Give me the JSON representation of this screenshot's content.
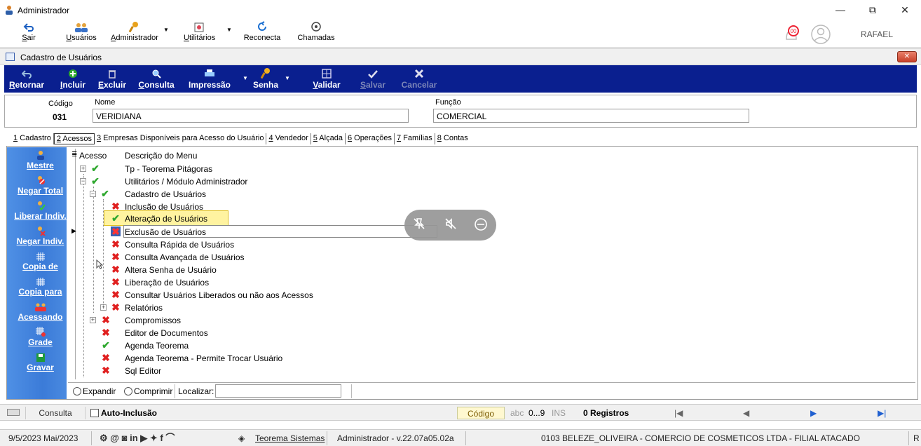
{
  "window": {
    "title": "Administrador",
    "minimize": "—",
    "maximize": "⧉",
    "close": "✕"
  },
  "main_toolbar": {
    "items": [
      {
        "label": "Sair",
        "key": "S",
        "rest": "air"
      },
      {
        "label": "Usuários",
        "key": "U",
        "rest": "suários"
      },
      {
        "label": "Administrador",
        "key": "A",
        "rest": "dministrador"
      },
      {
        "label": "Utilitários",
        "key": "U",
        "rest": "tilitários"
      },
      {
        "label": "Reconecta"
      },
      {
        "label": "Chamadas"
      }
    ],
    "notification_badge": "00",
    "user": "RAFAEL"
  },
  "subwindow": {
    "title": "Cadastro de Usuários",
    "close": "✕"
  },
  "form_toolbar": {
    "retornar": {
      "key": "R",
      "rest": "etornar"
    },
    "incluir": {
      "key": "I",
      "rest": "ncluir"
    },
    "excluir": {
      "key": "E",
      "rest": "xcluir"
    },
    "consulta": {
      "key": "C",
      "rest": "onsulta"
    },
    "impressao": {
      "label": "Impressão"
    },
    "senha": {
      "label": "Senha"
    },
    "validar": {
      "key": "V",
      "rest": "alidar"
    },
    "salvar": {
      "key": "S",
      "rest": "alvar"
    },
    "cancelar": {
      "label": "Cancelar"
    }
  },
  "fields": {
    "codigo_label": "Código",
    "codigo_value": "031",
    "nome_label": "Nome",
    "nome_value": "VERIDIANA",
    "funcao_label": "Função",
    "funcao_value": "COMERCIAL"
  },
  "tabs": [
    {
      "num": "1",
      "label": " Cadastro"
    },
    {
      "num": "2",
      "label": " Acessos"
    },
    {
      "num": "3",
      "label": " Empresas Disponíveis para Acesso do Usuário"
    },
    {
      "num": "4",
      "label": " Vendedor"
    },
    {
      "num": "5",
      "label": " Alçada"
    },
    {
      "num": "6",
      "label": " Operações"
    },
    {
      "num": "7",
      "label": " Famílias"
    },
    {
      "num": "8",
      "label": " Contas"
    }
  ],
  "sidebar": {
    "items": [
      {
        "label": "Mestre",
        "icon": "user-icon"
      },
      {
        "label": "Negar Total",
        "icon": "deny-icon"
      },
      {
        "label": "Liberar Indiv.",
        "icon": "user-check-icon"
      },
      {
        "label": "Negar Indiv.",
        "icon": "user-cross-icon"
      },
      {
        "label": "Copia de",
        "icon": "grid-icon"
      },
      {
        "label": "Copia para",
        "icon": "grid-icon"
      },
      {
        "label": "Acessando",
        "icon": "users-icon"
      },
      {
        "label": "Grade",
        "icon": "grid-icon"
      },
      {
        "label": "Gravar",
        "icon": "save-icon"
      }
    ]
  },
  "grid": {
    "header_access": "Acesso",
    "header_desc": "Descrição do Menu",
    "rows": [
      {
        "text": "Tp - Teorema Pitágoras",
        "status": "check"
      },
      {
        "text": "Utilitários / Módulo Administrador",
        "status": "check"
      },
      {
        "text": "Cadastro de Usuários",
        "status": "check"
      },
      {
        "text": "Inclusão de Usuários",
        "status": "cross"
      },
      {
        "text": "Alteração de Usuários",
        "status": "check"
      },
      {
        "text": "Exclusão de Usuários",
        "status": "cross"
      },
      {
        "text": "Consulta Rápida de Usuários",
        "status": "cross"
      },
      {
        "text": "Consulta Avançada de Usuários",
        "status": "cross"
      },
      {
        "text": "Altera Senha de Usuário",
        "status": "cross"
      },
      {
        "text": "Liberação de Usuários",
        "status": "cross"
      },
      {
        "text": "Consultar Usuários Liberados ou não aos Acessos",
        "status": "cross"
      },
      {
        "text": "Relatórios",
        "status": "cross"
      },
      {
        "text": "Compromissos",
        "status": "cross"
      },
      {
        "text": "Editor de Documentos",
        "status": "cross"
      },
      {
        "text": "Agenda Teorema",
        "status": "check"
      },
      {
        "text": "Agenda Teorema - Permite Trocar Usuário",
        "status": "cross"
      },
      {
        "text": "Sql Editor",
        "status": "cross"
      }
    ],
    "expandir": "Expandir",
    "comprimir": "Comprimir",
    "localizar": "Localizar:",
    "localizar_value": ""
  },
  "bottom_bar": {
    "consulta": "Consulta",
    "auto_inclusao": "Auto-Inclusão",
    "codigo": "Código",
    "abc": "abc",
    "range": "0...9",
    "ins": "INS",
    "registros": "0 Registros"
  },
  "status_bar": {
    "date": "9/5/2023 Mai/2023",
    "brand": "Teorema Sistemas",
    "version": "Administrador - v.22.07a05.02a",
    "company": "0103 BELEZE_OLIVEIRA - COMERCIO DE COSMETICOS LTDA - FILIAL ATACADO",
    "tail": "R"
  },
  "colors": {
    "toolbar_blue": "#0a1f8f",
    "sidebar_blue": "#3b7bd8",
    "highlight_yellow": "#fff3a0"
  }
}
